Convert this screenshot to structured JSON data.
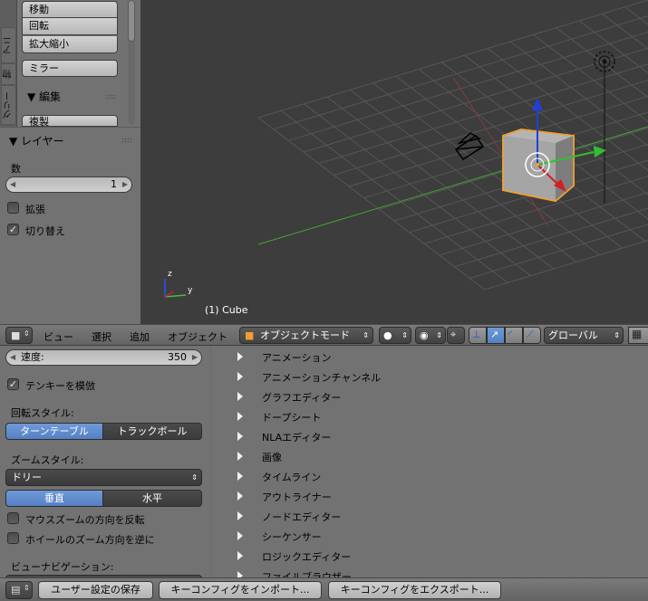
{
  "tool_shelf": {
    "tabs": [
      "アニ",
      "物",
      "グリー"
    ],
    "transform_buttons": [
      "移動",
      "回転",
      "拡大縮小"
    ],
    "mirror_button": "ミラー",
    "edit_header": "▼ 編集",
    "duplicate_button": "複製"
  },
  "layer_panel": {
    "header": "▼ レイヤー",
    "number_label": "数",
    "number_value": "1",
    "extend_label": "拡張",
    "extend_checked": false,
    "toggle_label": "切り替え",
    "toggle_checked": true
  },
  "viewport": {
    "object_label": "(1) Cube",
    "axis_z": "z",
    "axis_y": "y",
    "background": "#3d3d3d",
    "selection_color": "#f0a030"
  },
  "header": {
    "menu_view": "ビュー",
    "menu_select": "選択",
    "menu_add": "追加",
    "menu_object": "オブジェクト",
    "mode_label": "オブジェクトモード",
    "orientation_label": "グローバル"
  },
  "prefs": {
    "speed_label": "速度:",
    "speed_value": "350",
    "emulate_numpad_label": "テンキーを模倣",
    "emulate_numpad_checked": true,
    "rotation_style_label": "回転スタイル:",
    "rotation_turntable": "ターンテーブル",
    "rotation_trackball": "トラックボール",
    "zoom_style_label": "ズームスタイル:",
    "zoom_style_value": "ドリー",
    "zoom_vertical": "垂直",
    "zoom_horizontal": "水平",
    "invert_mouse_zoom_label": "マウスズームの方向を反転",
    "invert_wheel_zoom_label": "ホイールのズーム方向を逆に",
    "view_navigation_label": "ビューナビゲーション:",
    "editors": [
      "アニメーション",
      "アニメーションチャンネル",
      "グラフエディター",
      "ドープシート",
      "NLAエディター",
      "画像",
      "タイムライン",
      "アウトライナー",
      "ノードエディター",
      "シーケンサー",
      "ロジックエディター",
      "ファイルブラウザー"
    ]
  },
  "footer": {
    "save_prefs": "ユーザー設定の保存",
    "import_keyconfig": "キーコンフィグをインポート...",
    "export_keyconfig": "キーコンフィグをエクスポート..."
  },
  "colors": {
    "accent_blue": "#5680c4",
    "panel_gray": "#727272"
  }
}
